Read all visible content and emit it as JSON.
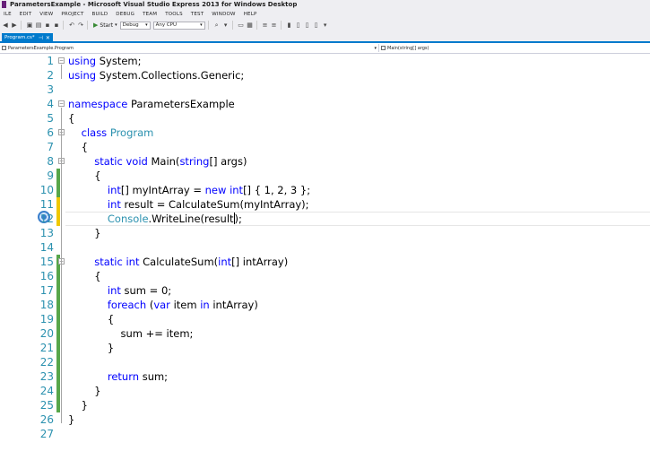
{
  "window": {
    "title": "ParametersExample - Microsoft Visual Studio Express 2013 for Windows Desktop"
  },
  "menu": [
    "ILE",
    "EDIT",
    "VIEW",
    "PROJECT",
    "BUILD",
    "DEBUG",
    "TEAM",
    "TOOLS",
    "TEST",
    "WINDOW",
    "HELP"
  ],
  "toolbar": {
    "start_label": "Start",
    "config_value": "Debug",
    "platform_value": "Any CPU"
  },
  "tab": {
    "label": "Program.cs*",
    "pin": "⊣",
    "close": "✕"
  },
  "navbar": {
    "left": "ParametersExample.Program",
    "right": "Main(string[] args)"
  },
  "colors": {
    "keyword": "#0000ff",
    "type": "#2b91af",
    "line_number": "#2b91af",
    "saved_change": "#57a64a",
    "unsaved_change": "#f0c800",
    "accent": "#007acc"
  },
  "editor": {
    "current_line": 12,
    "lines": [
      {
        "n": "1",
        "code": "using System;"
      },
      {
        "n": "2",
        "code": "using System.Collections.Generic;"
      },
      {
        "n": "3",
        "code": ""
      },
      {
        "n": "4",
        "code": "namespace ParametersExample"
      },
      {
        "n": "5",
        "code": "{"
      },
      {
        "n": "6",
        "code": "    class Program"
      },
      {
        "n": "7",
        "code": "    {"
      },
      {
        "n": "8",
        "code": "        static void Main(string[] args)"
      },
      {
        "n": "9",
        "code": "        {"
      },
      {
        "n": "10",
        "code": "            int[] myIntArray = new int[] { 1, 2, 3 };"
      },
      {
        "n": "11",
        "code": "            int result = CalculateSum(myIntArray);"
      },
      {
        "n": "12",
        "code": "            Console.WriteLine(result);"
      },
      {
        "n": "13",
        "code": "        }"
      },
      {
        "n": "14",
        "code": ""
      },
      {
        "n": "15",
        "code": "        static int CalculateSum(int[] intArray)"
      },
      {
        "n": "16",
        "code": "        {"
      },
      {
        "n": "17",
        "code": "            int sum = 0;"
      },
      {
        "n": "18",
        "code": "            foreach (var item in intArray)"
      },
      {
        "n": "19",
        "code": "            {"
      },
      {
        "n": "20",
        "code": "                sum += item;"
      },
      {
        "n": "21",
        "code": "            }"
      },
      {
        "n": "22",
        "code": ""
      },
      {
        "n": "23",
        "code": "            return sum;"
      },
      {
        "n": "24",
        "code": "        }"
      },
      {
        "n": "25",
        "code": "    }"
      },
      {
        "n": "26",
        "code": "}"
      },
      {
        "n": "27",
        "code": ""
      }
    ]
  }
}
